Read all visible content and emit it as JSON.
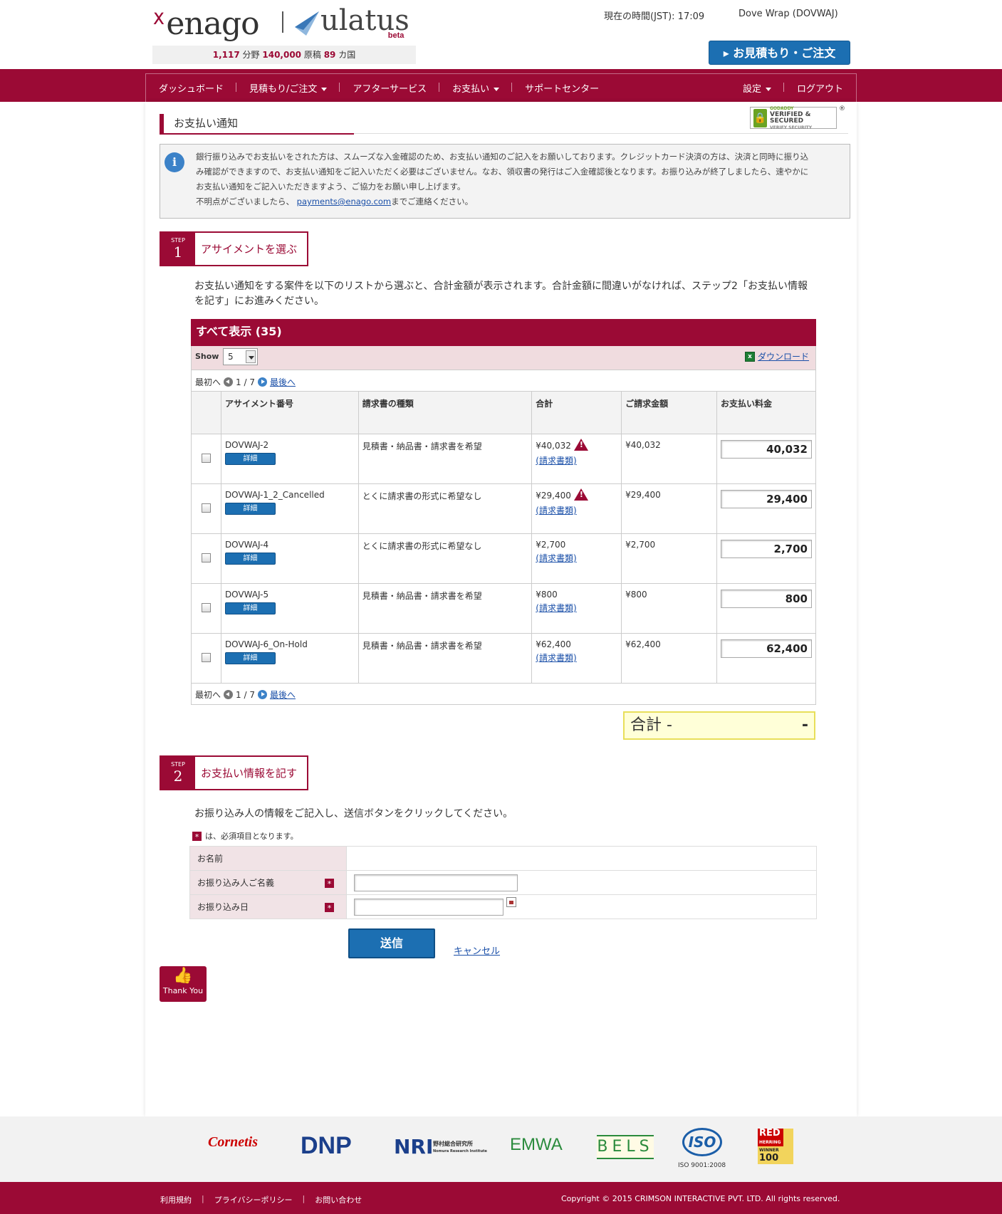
{
  "header": {
    "brand_enago": "enago",
    "brand_ulatus": "ulatus",
    "brand_beta": "beta",
    "stats": {
      "fields": "1,117",
      "fields_unit": "分野",
      "manuscripts": "140,000",
      "manuscripts_unit": "原稿",
      "countries": "89",
      "countries_unit": "カ国"
    },
    "time_label": "現在の時間(JST): 17:09",
    "user": "Dove Wrap (DOVWAJ)",
    "quote_button": "お見積もり・ご注文"
  },
  "nav": {
    "items": [
      {
        "label": "ダッシュボード"
      },
      {
        "label": "見積もり/ご注文"
      },
      {
        "label": "アフターサービス"
      },
      {
        "label": "お支払い"
      },
      {
        "label": "サポートセンター"
      }
    ],
    "settings": "設定",
    "logout": "ログアウト"
  },
  "page": {
    "title": "お支払い通知",
    "godaddy_line1": "GODADDY",
    "godaddy_line2": "VERIFIED & SECURED",
    "godaddy_line3": "VERIFY SECURITY",
    "info_lines": [
      "銀行振り込みでお支払いをされた方は、スムーズな入金確認のため、お支払い通知のご記入をお願いしております。クレジットカード決済の方は、決済と同時に振り込",
      "み確認ができますので、お支払い通知をご記入いただく必要はございません。なお、領収書の発行はご入金確認後となります。お振り込みが終了しましたら、速やかに",
      "お支払い通知をご記入いただきますよう、ご協力をお願い申し上げます。"
    ],
    "info_contact_prefix": "不明点がございましたら、",
    "info_contact_email": "payments@enago.com",
    "info_contact_suffix": "までご連絡ください。"
  },
  "step1": {
    "step_word": "STEP",
    "number": "1",
    "label": "アサイメントを選ぶ",
    "description": "お支払い通知をする案件を以下のリストから選ぶと、合計金額が表示されます。合計金額に間違いがなければ、ステップ2「お支払い情報を記す」にお進みください。"
  },
  "table": {
    "header": "すべて表示 (35)",
    "show_label": "Show",
    "show_value": "5",
    "download": "ダウンロード",
    "pager": {
      "first": "最初へ",
      "page": "1 / 7",
      "last": "最後へ"
    },
    "columns": [
      "アサイメント番号",
      "請求書の種類",
      "合計",
      "ご請求金額",
      "お支払い料金"
    ],
    "detail_label": "詳細",
    "invoice_link": "(請求書類)",
    "rows": [
      {
        "id": "DOVWAJ-2",
        "type": "見積書・納品書・請求書を希望",
        "total": "¥40,032",
        "warn": true,
        "billed": "¥40,032",
        "payment": "40,032"
      },
      {
        "id": "DOVWAJ-1_2_Cancelled",
        "type": "とくに請求書の形式に希望なし",
        "total": "¥29,400",
        "warn": true,
        "billed": "¥29,400",
        "payment": "29,400"
      },
      {
        "id": "DOVWAJ-4",
        "type": "とくに請求書の形式に希望なし",
        "total": "¥2,700",
        "warn": false,
        "billed": "¥2,700",
        "payment": "2,700"
      },
      {
        "id": "DOVWAJ-5",
        "type": "見積書・納品書・請求書を希望",
        "total": "¥800",
        "warn": false,
        "billed": "¥800",
        "payment": "800"
      },
      {
        "id": "DOVWAJ-6_On-Hold",
        "type": "見積書・納品書・請求書を希望",
        "total": "¥62,400",
        "warn": false,
        "billed": "¥62,400",
        "payment": "62,400"
      }
    ],
    "total_label": "合計 -",
    "total_value": "-"
  },
  "step2": {
    "step_word": "STEP",
    "number": "2",
    "label": "お支払い情報を記す",
    "description": "お振り込み人の情報をご記入し、送信ボタンをクリックしてください。",
    "required_mark": "*",
    "required_note": "は、必須項目となります。",
    "fields": {
      "name": "お名前",
      "remitter": "お振り込み人ご名義",
      "date": "お振り込み日"
    },
    "submit": "送信",
    "cancel": "キャンセル",
    "thankyou": "Thank You"
  },
  "partners": {
    "cornetis": "Cornetis",
    "dnp": "DNP",
    "nri": "NRI",
    "nri_jp": "野村総合研究所",
    "nri_en": "Nomura Research Institute",
    "emwa": "EMWA",
    "bels": "BELS",
    "iso": "ISO",
    "iso_caption": "ISO 9001:2008",
    "red": "RED",
    "red_herring": "HERRING",
    "red_global": "GLOBAL",
    "red_winner": "WINNER",
    "red_100": "100"
  },
  "footer": {
    "links": [
      "利用規約",
      "プライバシーポリシー",
      "お問い合わせ"
    ],
    "copyright": "Copyright © 2015 CRIMSON INTERACTIVE PVT. LTD. All rights reserved."
  },
  "colors": {
    "brand": "#9b0a35",
    "accent": "#1c6fb2",
    "total_bg": "#ffffd8"
  }
}
